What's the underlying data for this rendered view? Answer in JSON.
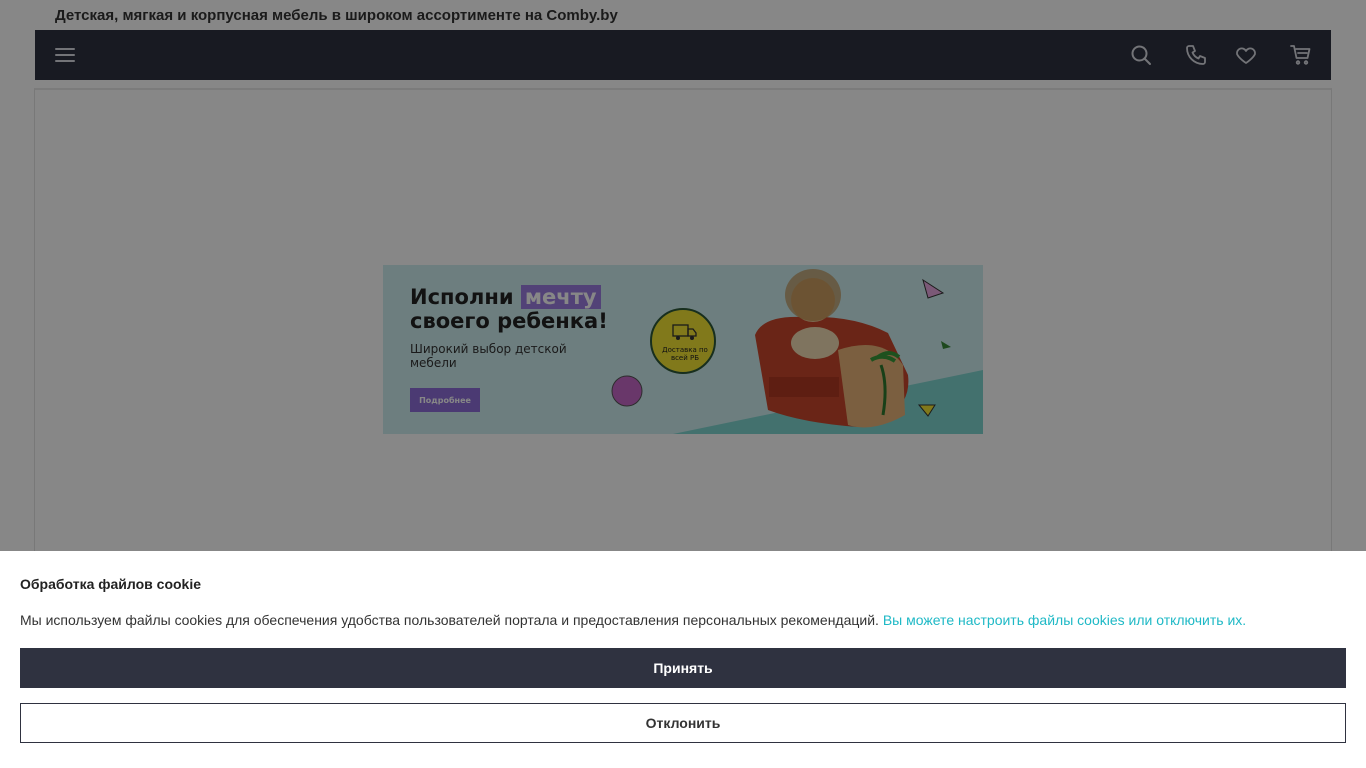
{
  "header": {
    "site_title": "Детская, мягкая и корпусная мебель в широком ассортименте на Comby.by"
  },
  "navbar": {
    "icons": [
      "menu-icon",
      "search-icon",
      "phone-icon",
      "heart-icon",
      "cart-icon"
    ]
  },
  "banner": {
    "headline_part1": "Исполни ",
    "headline_highlight": "мечту",
    "headline_part2": "своего ребенка!",
    "subtitle": "Широкий выбор детской мебели",
    "button_label": "Подробнее",
    "badge_text": "Доставка по всей РБ"
  },
  "cookie": {
    "title": "Обработка файлов cookie",
    "text": "Мы используем файлы cookies для обеспечения удобства пользователей портала и предоставления персональных рекомендаций.",
    "link": "Вы можете настроить файлы cookies или отключить их.",
    "accept_label": "Принять",
    "decline_label": "Отклонить"
  },
  "colors": {
    "navbar_bg": "#2f3240",
    "link": "#1fb9c6",
    "banner_accent": "#9b7ee0"
  }
}
